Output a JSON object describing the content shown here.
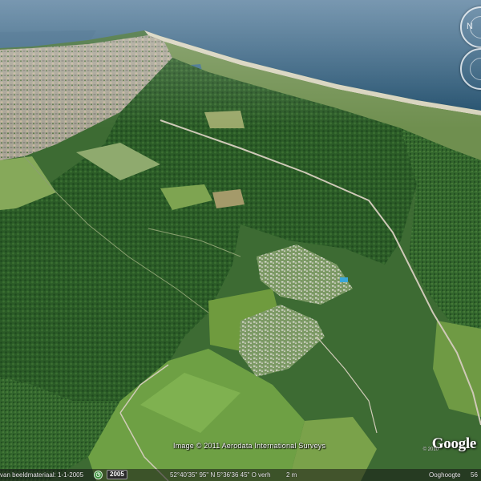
{
  "map": {
    "layer": "satellite",
    "view": "oblique 3D aerial",
    "colors": {
      "sea": "#2d5a78",
      "sea_far": "#3f6d8d",
      "beach": "#d9d6c3",
      "dunes": "#7c9a5a",
      "town": "#b9b1a2",
      "forest_dark": "#1f4a20",
      "forest": "#2e5f2a",
      "forest_light": "#3f7434",
      "field_green": "#6f9a44",
      "field_light": "#92b35c",
      "road": "#c9c4b6"
    }
  },
  "attribution": {
    "copyright": "Image © 2011 Aerodata International Surveys",
    "logo": "Google",
    "logo_year": "© 2010"
  },
  "statusbar": {
    "imagery_date": "van beeldmateriaal: 1-1-2005",
    "year_badge": "2005",
    "coordinates": "52°40'35\" 95\" N   5°36'36 45\" O  verh",
    "elevation": "2 m",
    "eye_alt": "Ooghoogte",
    "eye_alt_value": "56"
  },
  "controls": {
    "navigation_icon": "compass-ring-icon",
    "look_icon": "look-joystick-icon",
    "move_icon": "move-joystick-icon",
    "tour_icon": "tour-icon"
  }
}
